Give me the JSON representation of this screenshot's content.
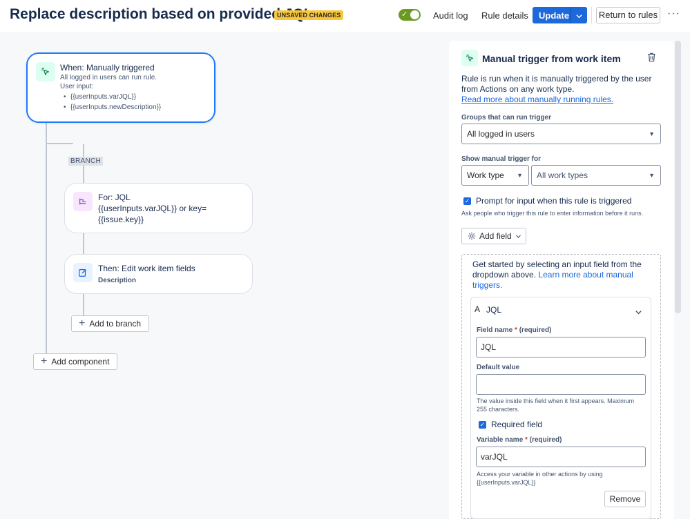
{
  "header": {
    "title": "Replace description based on provided JQL",
    "badge": "UNSAVED CHANGES",
    "audit_log": "Audit log",
    "rule_details": "Rule details",
    "update": "Update",
    "return_to_rules": "Return to rules",
    "more": "···",
    "toggle_enabled": true
  },
  "canvas": {
    "trigger": {
      "title": "When: Manually triggered",
      "line1": "All logged in users can run rule.",
      "line2": "User input:",
      "input1": "{{userInputs.varJQL}}",
      "input2": "{{userInputs.newDescription}}"
    },
    "branch_label": "BRANCH",
    "branch_node": {
      "line1": "For: JQL",
      "line2": "{{userInputs.varJQL}} or key=",
      "line3": "{{issue.key}}"
    },
    "action_node": {
      "title": "Then: Edit work item fields",
      "sub": "Description"
    },
    "add_to_branch": "Add to branch",
    "add_component": "Add component"
  },
  "panel": {
    "title": "Manual trigger from work item",
    "description": "Rule is run when it is manually triggered by the user from Actions on any work type.",
    "read_more": "Read more about manually running rules.",
    "groups_label": "Groups that can run trigger",
    "groups_value": "All logged in users",
    "show_for_label": "Show manual trigger for",
    "show_for_type": "Work type",
    "show_for_value": "All work types",
    "prompt_label": "Prompt for input when this rule is triggered",
    "prompt_checked": true,
    "prompt_help": "Ask people who trigger this rule to enter information before it runs.",
    "add_field": "Add field",
    "get_started": "Get started by selecting an input field from the dropdown above.",
    "learn_more": "Learn more about manual triggers.",
    "field": {
      "type": "JQL",
      "field_name_label": "Field name",
      "required_star": "*",
      "required_text": "(required)",
      "field_name_value": "JQL",
      "default_label": "Default value",
      "default_value": "",
      "default_help": "The value inside this field when it first appears. Maximum 255 characters.",
      "required_field_label": "Required field",
      "required_field_checked": true,
      "variable_label": "Variable name",
      "variable_value": "varJQL",
      "variable_help": "Access your variable in other actions by using {{userInputs.varJQL}}",
      "remove": "Remove"
    }
  }
}
